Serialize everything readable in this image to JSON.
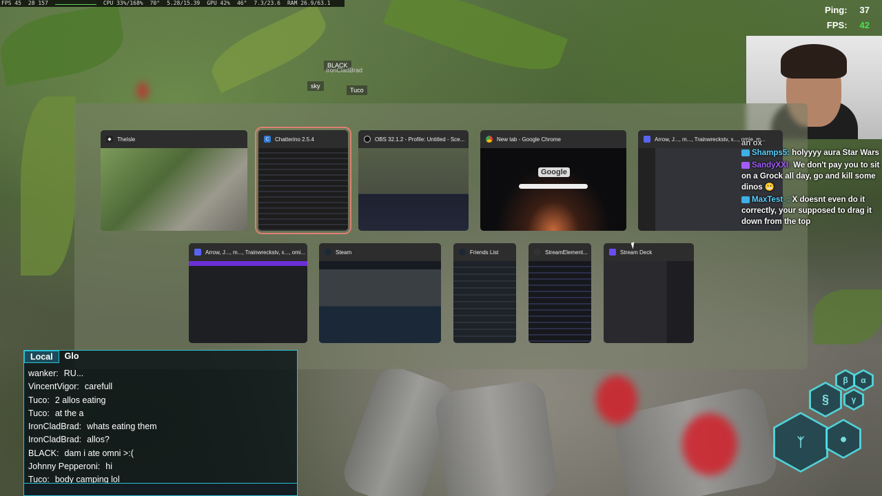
{
  "perf": {
    "fps": "FPS 45",
    "frametime": "28 157",
    "cpu": "CPU 33%/168%",
    "cpu_temp": "70°",
    "mem": "5.28/15.39",
    "gpu": "GPU 42%",
    "gpu_temp": "46°",
    "vram": "7.3/23.6",
    "ram": "RAM 26.9/63.1"
  },
  "netstats": {
    "ping_label": "Ping:",
    "ping_value": "37",
    "fps_label": "FPS:",
    "fps_value": "42"
  },
  "name_tags": {
    "black": "BLACK",
    "ironclad": "IronCladBrad",
    "sky": "sky",
    "tuco": "Tuco"
  },
  "task_switcher": {
    "row1": [
      {
        "title": "TheIsle",
        "icon": "game-icon",
        "selected": false
      },
      {
        "title": "Chatterino 2.5.4",
        "icon": "chatterino-icon",
        "selected": true
      },
      {
        "title": "OBS 32.1.2 - Profile: Untitled - Sce...",
        "icon": "obs-icon",
        "selected": false
      },
      {
        "title": "New tab - Google Chrome",
        "icon": "chrome-icon",
        "selected": false
      },
      {
        "title": "Arrow, J..., m..., Trainwreckstv, x..., omie, m...",
        "icon": "discord-icon",
        "selected": false
      }
    ],
    "row2": [
      {
        "title": "Arrow, J..., m..., Trainwreckstv, x..., omi...",
        "icon": "discord-icon",
        "selected": false
      },
      {
        "title": "Steam",
        "icon": "steam-icon",
        "selected": false
      },
      {
        "title": "Friends List",
        "icon": "steam-icon",
        "selected": false
      },
      {
        "title": "StreamElement...",
        "icon": "streamelements-icon",
        "selected": false
      },
      {
        "title": "Stream Deck",
        "icon": "streamdeck-icon",
        "selected": false
      }
    ],
    "chrome_logo": "Google"
  },
  "stream_chat": {
    "partial_top": "an ox",
    "messages": [
      {
        "user": "Shamps5:",
        "text": "holyyyy aura Star Wars",
        "user_color": "#5ad1ff"
      },
      {
        "user": "SandyXXI:",
        "text": "We don't pay you to sit on a Grock all day, go and kill some dinos",
        "user_color": "#a35cff"
      },
      {
        "user": "MaxTest_:",
        "text": "X doesnt even do it correctly, your supposed to drag it down from the top",
        "user_color": "#5ad1ff"
      }
    ]
  },
  "game_chat": {
    "tabs": [
      "Local",
      "Glo"
    ],
    "lines": [
      {
        "who": "wanker:",
        "text": "RU..."
      },
      {
        "who": "VincentVigor:",
        "text": "carefull"
      },
      {
        "who": "Tuco:",
        "text": "2 allos eating"
      },
      {
        "who": "Tuco:",
        "text": "at the a"
      },
      {
        "who": "IronCladBrad:",
        "text": "whats eating them"
      },
      {
        "who": "IronCladBrad:",
        "text": "allos?"
      },
      {
        "who": "BLACK:",
        "text": "dam i ate omni >:("
      },
      {
        "who": "Johnny Pepperoni:",
        "text": "hi"
      },
      {
        "who": "Tuco:",
        "text": "body camping lol"
      }
    ]
  },
  "colors": {
    "accent_cyan": "#29c1d6",
    "selection_outline": "#e07f74",
    "fps_green": "#4fe04f"
  }
}
